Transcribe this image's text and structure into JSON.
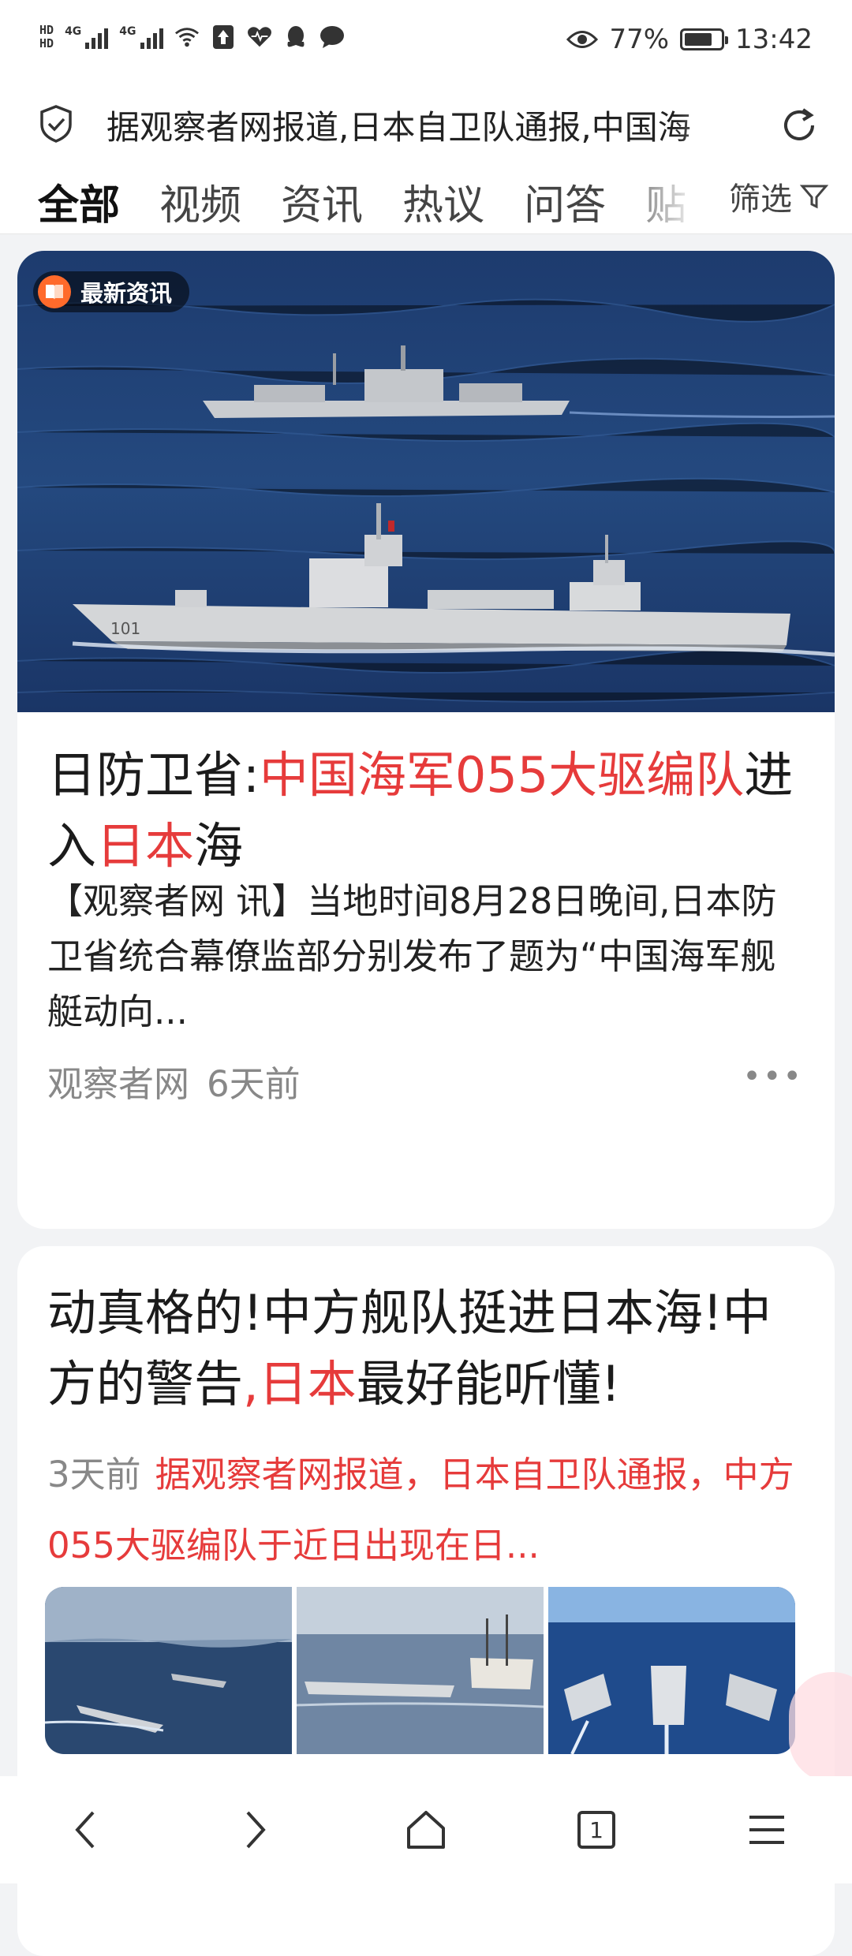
{
  "status_bar": {
    "hd_labels": [
      "HD",
      "HD"
    ],
    "network": [
      "4G",
      "4G"
    ],
    "battery_percent": 77,
    "battery_text": "77%",
    "time": "13:42",
    "icons": [
      "signal-icon",
      "wifi-icon",
      "upload-icon",
      "health-icon",
      "qq-icon",
      "chat-icon",
      "eye-icon",
      "battery-icon"
    ]
  },
  "search": {
    "query": "据观察者网报道,日本自卫队通报,中国海"
  },
  "tabs": {
    "items": [
      "全部",
      "视频",
      "资讯",
      "热议",
      "问答",
      "贴"
    ],
    "active_index": 0,
    "filter_label": "筛选"
  },
  "card1": {
    "badge": "最新资讯",
    "title_parts": [
      {
        "text": "日防卫省:",
        "highlight": false
      },
      {
        "text": "中国海军055大驱编队",
        "highlight": true
      },
      {
        "text": "进入",
        "highlight": false
      },
      {
        "text": "日本",
        "highlight": true
      },
      {
        "text": "海",
        "highlight": false
      }
    ],
    "summary": "【观察者网 讯】当地时间8月28日晚间,日本防卫省统合幕僚监部分别发布了题为“中国海军舰艇动向...",
    "source": "观察者网",
    "time": "6天前",
    "more_label": "•••",
    "hero_hull_number": "101"
  },
  "card2": {
    "title_parts": [
      {
        "text": "动真格的!中方舰队挺进日本海!中方的警告",
        "highlight": false
      },
      {
        "text": ",日本",
        "highlight": true
      },
      {
        "text": "最好能听懂!",
        "highlight": false
      }
    ],
    "time": "3天前",
    "snippet": "据观察者网报道，日本自卫队通报，中方055大驱编队于近日出现在日..."
  },
  "colors": {
    "accent_blue": "#1e6fe5",
    "highlight_red": "#e63b3b",
    "badge_orange": "#ff6a2b"
  },
  "nav": {
    "tab_count": "1",
    "items": [
      "back-icon",
      "forward-icon",
      "home-icon",
      "tabs-icon",
      "menu-icon"
    ]
  }
}
